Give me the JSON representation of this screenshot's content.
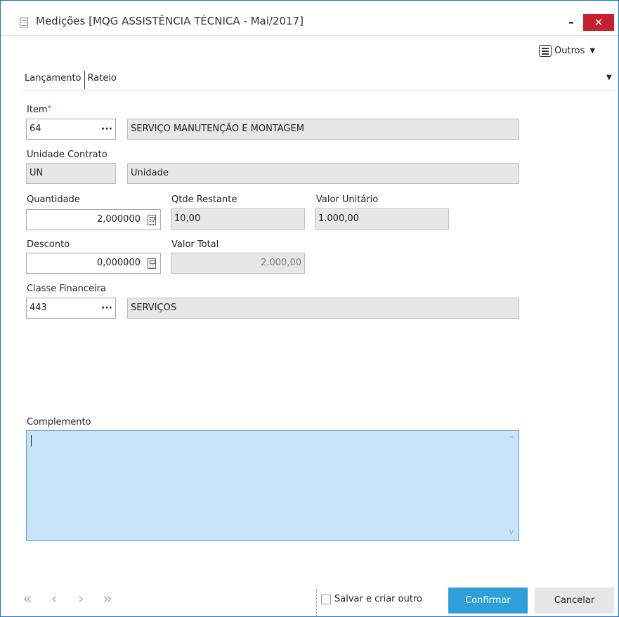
{
  "window": {
    "title": "Medições [MQG ASSISTÊNCIA TÉCNICA - Mai/2017]",
    "minimize_label": "–",
    "close_label": "✕"
  },
  "toolbar": {
    "outros_label": "Outros"
  },
  "tabs": [
    {
      "label": "Lançamento",
      "active": true
    },
    {
      "label": "Rateio",
      "active": false
    }
  ],
  "form": {
    "item": {
      "label": "Item",
      "required_mark": "*",
      "code": "64",
      "lookup_label": "···",
      "description": "SERVIÇO MANUTENÇÃO E MONTAGEM"
    },
    "unidade_contrato": {
      "label": "Unidade Contrato",
      "code": "UN",
      "description": "Unidade"
    },
    "quantidade": {
      "label": "Quantidade",
      "value": "2,000000"
    },
    "qtde_restante": {
      "label": "Qtde Restante",
      "value": "10,00"
    },
    "valor_unitario": {
      "label": "Valor Unitário",
      "value": "1.000,00"
    },
    "desconto": {
      "label": "Desconto",
      "value": "0,000000"
    },
    "valor_total": {
      "label": "Valor Total",
      "value": "2.000,00"
    },
    "classe_financeira": {
      "label": "Classe Financeira",
      "code": "443",
      "lookup_label": "···",
      "description": "SERVIÇOS"
    },
    "complemento": {
      "label": "Complemento",
      "value": ""
    }
  },
  "footer": {
    "nav": [
      "«",
      "‹",
      "›",
      "»"
    ],
    "save_and_create_label": "Salvar e criar outro",
    "save_and_create_checked": false,
    "confirm_label": "Confirmar",
    "cancel_label": "Cancelar"
  },
  "colors": {
    "confirm_bg": "#2e9fd8",
    "close_bg": "#c9202f",
    "textarea_bg": "#c7e4f8",
    "window_border": "#1e73be"
  }
}
